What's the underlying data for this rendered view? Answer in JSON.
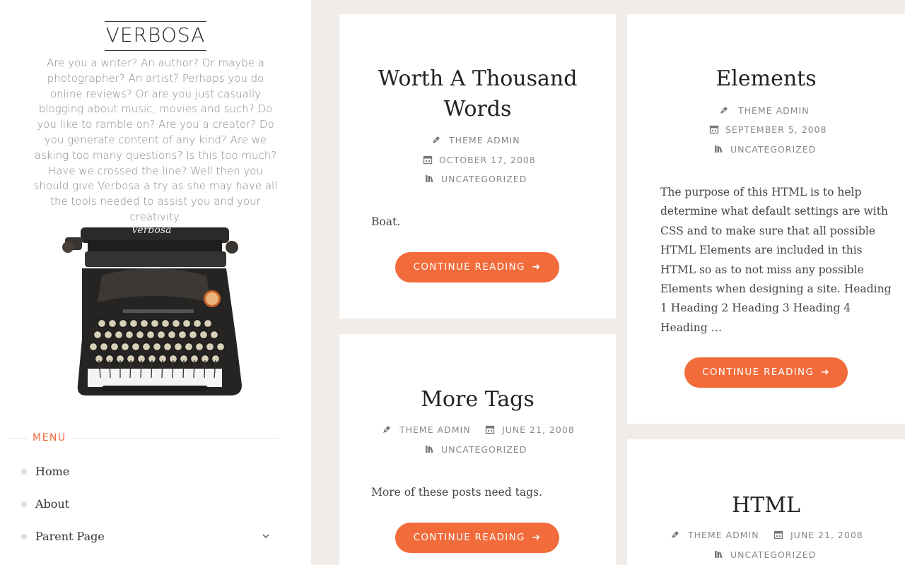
{
  "site": {
    "title": "VERBOSA",
    "tagline": "Are you a writer? An author? Or maybe a photographer? An artist? Perhaps you do online reviews? Or are you just casually blogging about music, movies and such? Do you like to ramble on? Are you a creator? Do you generate content of any kind? Are we asking too many questions? Is this too much? Have we crossed the line? Well then you should give Verbosa a try as she may have all the tools needed to assist you and your creativity.",
    "image_text": "Verbosa"
  },
  "menu": {
    "heading": "MENU",
    "items": [
      {
        "label": "Home"
      },
      {
        "label": "About"
      },
      {
        "label": "Parent Page"
      }
    ]
  },
  "posts": [
    {
      "title_line1": "Worth A Thousand",
      "title_line2": "Words",
      "author": "THEME ADMIN",
      "date": "OCTOBER 17, 2008",
      "category": "UNCATEGORIZED",
      "excerpt": "Boat.",
      "button": "CONTINUE READING"
    },
    {
      "title": "Elements",
      "author": "THEME ADMIN",
      "date": "SEPTEMBER 5, 2008",
      "category": "UNCATEGORIZED",
      "excerpt_lines": [
        "The purpose of this HTML is to help",
        "determine what default settings are with",
        "CSS and to make sure that all possible",
        "HTML Elements are included in this",
        "HTML so as to not miss any possible",
        "Elements when designing a site. Heading",
        "1 Heading 2 Heading 3 Heading 4",
        "Heading …"
      ],
      "button": "CONTINUE READING"
    },
    {
      "title": "More Tags",
      "author": "THEME ADMIN",
      "date": "JUNE 21, 2008",
      "category": "UNCATEGORIZED",
      "excerpt": "More of these posts need tags.",
      "button": "CONTINUE READING"
    },
    {
      "title": "HTML",
      "author": "THEME ADMIN",
      "date": "JUNE 21, 2008",
      "category": "UNCATEGORIZED"
    }
  ],
  "icons": {
    "author": "pen-nib-icon",
    "date": "calendar-icon",
    "category": "books-icon",
    "button_arrow": "arrow-right-icon",
    "submenu": "chevron-down-icon",
    "bullet": "bullet-dot"
  },
  "colors": {
    "accent": "#f26b3a",
    "background": "#f1ece8",
    "card": "#ffffff",
    "muted_text": "#888888"
  }
}
